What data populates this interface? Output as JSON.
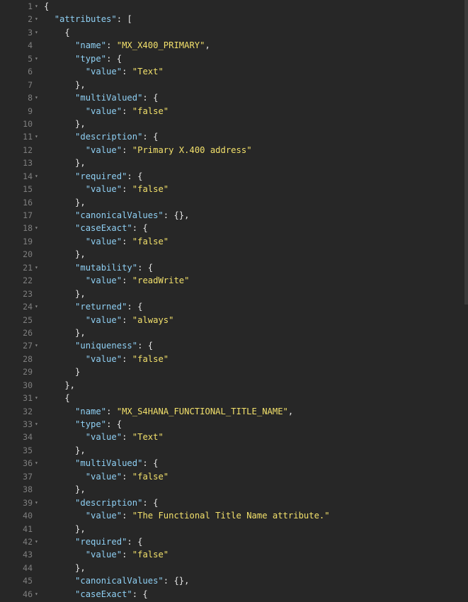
{
  "editor": {
    "lines": [
      {
        "n": "1",
        "fold": true,
        "tokens": [
          {
            "t": "{",
            "c": "punc"
          }
        ]
      },
      {
        "n": "2",
        "fold": true,
        "tokens": [
          {
            "t": "  ",
            "c": "punc"
          },
          {
            "t": "\"attributes\"",
            "c": "key"
          },
          {
            "t": ": [",
            "c": "punc"
          }
        ]
      },
      {
        "n": "3",
        "fold": true,
        "tokens": [
          {
            "t": "    {",
            "c": "punc"
          }
        ]
      },
      {
        "n": "4",
        "fold": false,
        "tokens": [
          {
            "t": "      ",
            "c": "punc"
          },
          {
            "t": "\"name\"",
            "c": "key"
          },
          {
            "t": ": ",
            "c": "punc"
          },
          {
            "t": "\"MX_X400_PRIMARY\"",
            "c": "str"
          },
          {
            "t": ",",
            "c": "punc"
          }
        ]
      },
      {
        "n": "5",
        "fold": true,
        "tokens": [
          {
            "t": "      ",
            "c": "punc"
          },
          {
            "t": "\"type\"",
            "c": "key"
          },
          {
            "t": ": {",
            "c": "punc"
          }
        ]
      },
      {
        "n": "6",
        "fold": false,
        "tokens": [
          {
            "t": "        ",
            "c": "punc"
          },
          {
            "t": "\"value\"",
            "c": "key"
          },
          {
            "t": ": ",
            "c": "punc"
          },
          {
            "t": "\"Text\"",
            "c": "str"
          }
        ]
      },
      {
        "n": "7",
        "fold": false,
        "tokens": [
          {
            "t": "      },",
            "c": "punc"
          }
        ]
      },
      {
        "n": "8",
        "fold": true,
        "tokens": [
          {
            "t": "      ",
            "c": "punc"
          },
          {
            "t": "\"multiValued\"",
            "c": "key"
          },
          {
            "t": ": {",
            "c": "punc"
          }
        ]
      },
      {
        "n": "9",
        "fold": false,
        "tokens": [
          {
            "t": "        ",
            "c": "punc"
          },
          {
            "t": "\"value\"",
            "c": "key"
          },
          {
            "t": ": ",
            "c": "punc"
          },
          {
            "t": "\"false\"",
            "c": "str"
          }
        ]
      },
      {
        "n": "10",
        "fold": false,
        "tokens": [
          {
            "t": "      },",
            "c": "punc"
          }
        ]
      },
      {
        "n": "11",
        "fold": true,
        "tokens": [
          {
            "t": "      ",
            "c": "punc"
          },
          {
            "t": "\"description\"",
            "c": "key"
          },
          {
            "t": ": {",
            "c": "punc"
          }
        ]
      },
      {
        "n": "12",
        "fold": false,
        "tokens": [
          {
            "t": "        ",
            "c": "punc"
          },
          {
            "t": "\"value\"",
            "c": "key"
          },
          {
            "t": ": ",
            "c": "punc"
          },
          {
            "t": "\"Primary X.400 address\"",
            "c": "str"
          }
        ]
      },
      {
        "n": "13",
        "fold": false,
        "tokens": [
          {
            "t": "      },",
            "c": "punc"
          }
        ]
      },
      {
        "n": "14",
        "fold": true,
        "tokens": [
          {
            "t": "      ",
            "c": "punc"
          },
          {
            "t": "\"required\"",
            "c": "key"
          },
          {
            "t": ": {",
            "c": "punc"
          }
        ]
      },
      {
        "n": "15",
        "fold": false,
        "tokens": [
          {
            "t": "        ",
            "c": "punc"
          },
          {
            "t": "\"value\"",
            "c": "key"
          },
          {
            "t": ": ",
            "c": "punc"
          },
          {
            "t": "\"false\"",
            "c": "str"
          }
        ]
      },
      {
        "n": "16",
        "fold": false,
        "tokens": [
          {
            "t": "      },",
            "c": "punc"
          }
        ]
      },
      {
        "n": "17",
        "fold": false,
        "tokens": [
          {
            "t": "      ",
            "c": "punc"
          },
          {
            "t": "\"canonicalValues\"",
            "c": "key"
          },
          {
            "t": ": {},",
            "c": "punc"
          }
        ]
      },
      {
        "n": "18",
        "fold": true,
        "tokens": [
          {
            "t": "      ",
            "c": "punc"
          },
          {
            "t": "\"caseExact\"",
            "c": "key"
          },
          {
            "t": ": {",
            "c": "punc"
          }
        ]
      },
      {
        "n": "19",
        "fold": false,
        "tokens": [
          {
            "t": "        ",
            "c": "punc"
          },
          {
            "t": "\"value\"",
            "c": "key"
          },
          {
            "t": ": ",
            "c": "punc"
          },
          {
            "t": "\"false\"",
            "c": "str"
          }
        ]
      },
      {
        "n": "20",
        "fold": false,
        "tokens": [
          {
            "t": "      },",
            "c": "punc"
          }
        ]
      },
      {
        "n": "21",
        "fold": true,
        "tokens": [
          {
            "t": "      ",
            "c": "punc"
          },
          {
            "t": "\"mutability\"",
            "c": "key"
          },
          {
            "t": ": {",
            "c": "punc"
          }
        ]
      },
      {
        "n": "22",
        "fold": false,
        "tokens": [
          {
            "t": "        ",
            "c": "punc"
          },
          {
            "t": "\"value\"",
            "c": "key"
          },
          {
            "t": ": ",
            "c": "punc"
          },
          {
            "t": "\"readWrite\"",
            "c": "str"
          }
        ]
      },
      {
        "n": "23",
        "fold": false,
        "tokens": [
          {
            "t": "      },",
            "c": "punc"
          }
        ]
      },
      {
        "n": "24",
        "fold": true,
        "tokens": [
          {
            "t": "      ",
            "c": "punc"
          },
          {
            "t": "\"returned\"",
            "c": "key"
          },
          {
            "t": ": {",
            "c": "punc"
          }
        ]
      },
      {
        "n": "25",
        "fold": false,
        "tokens": [
          {
            "t": "        ",
            "c": "punc"
          },
          {
            "t": "\"value\"",
            "c": "key"
          },
          {
            "t": ": ",
            "c": "punc"
          },
          {
            "t": "\"always\"",
            "c": "str"
          }
        ]
      },
      {
        "n": "26",
        "fold": false,
        "tokens": [
          {
            "t": "      },",
            "c": "punc"
          }
        ]
      },
      {
        "n": "27",
        "fold": true,
        "tokens": [
          {
            "t": "      ",
            "c": "punc"
          },
          {
            "t": "\"uniqueness\"",
            "c": "key"
          },
          {
            "t": ": {",
            "c": "punc"
          }
        ]
      },
      {
        "n": "28",
        "fold": false,
        "tokens": [
          {
            "t": "        ",
            "c": "punc"
          },
          {
            "t": "\"value\"",
            "c": "key"
          },
          {
            "t": ": ",
            "c": "punc"
          },
          {
            "t": "\"false\"",
            "c": "str"
          }
        ]
      },
      {
        "n": "29",
        "fold": false,
        "tokens": [
          {
            "t": "      }",
            "c": "punc"
          }
        ]
      },
      {
        "n": "30",
        "fold": false,
        "tokens": [
          {
            "t": "    },",
            "c": "punc"
          }
        ]
      },
      {
        "n": "31",
        "fold": true,
        "tokens": [
          {
            "t": "    {",
            "c": "punc"
          }
        ]
      },
      {
        "n": "32",
        "fold": false,
        "tokens": [
          {
            "t": "      ",
            "c": "punc"
          },
          {
            "t": "\"name\"",
            "c": "key"
          },
          {
            "t": ": ",
            "c": "punc"
          },
          {
            "t": "\"MX_S4HANA_FUNCTIONAL_TITLE_NAME\"",
            "c": "str"
          },
          {
            "t": ",",
            "c": "punc"
          }
        ]
      },
      {
        "n": "33",
        "fold": true,
        "tokens": [
          {
            "t": "      ",
            "c": "punc"
          },
          {
            "t": "\"type\"",
            "c": "key"
          },
          {
            "t": ": {",
            "c": "punc"
          }
        ]
      },
      {
        "n": "34",
        "fold": false,
        "tokens": [
          {
            "t": "        ",
            "c": "punc"
          },
          {
            "t": "\"value\"",
            "c": "key"
          },
          {
            "t": ": ",
            "c": "punc"
          },
          {
            "t": "\"Text\"",
            "c": "str"
          }
        ]
      },
      {
        "n": "35",
        "fold": false,
        "tokens": [
          {
            "t": "      },",
            "c": "punc"
          }
        ]
      },
      {
        "n": "36",
        "fold": true,
        "tokens": [
          {
            "t": "      ",
            "c": "punc"
          },
          {
            "t": "\"multiValued\"",
            "c": "key"
          },
          {
            "t": ": {",
            "c": "punc"
          }
        ]
      },
      {
        "n": "37",
        "fold": false,
        "tokens": [
          {
            "t": "        ",
            "c": "punc"
          },
          {
            "t": "\"value\"",
            "c": "key"
          },
          {
            "t": ": ",
            "c": "punc"
          },
          {
            "t": "\"false\"",
            "c": "str"
          }
        ]
      },
      {
        "n": "38",
        "fold": false,
        "tokens": [
          {
            "t": "      },",
            "c": "punc"
          }
        ]
      },
      {
        "n": "39",
        "fold": true,
        "tokens": [
          {
            "t": "      ",
            "c": "punc"
          },
          {
            "t": "\"description\"",
            "c": "key"
          },
          {
            "t": ": {",
            "c": "punc"
          }
        ]
      },
      {
        "n": "40",
        "fold": false,
        "tokens": [
          {
            "t": "        ",
            "c": "punc"
          },
          {
            "t": "\"value\"",
            "c": "key"
          },
          {
            "t": ": ",
            "c": "punc"
          },
          {
            "t": "\"The Functional Title Name attribute.\"",
            "c": "str"
          }
        ]
      },
      {
        "n": "41",
        "fold": false,
        "tokens": [
          {
            "t": "      },",
            "c": "punc"
          }
        ]
      },
      {
        "n": "42",
        "fold": true,
        "tokens": [
          {
            "t": "      ",
            "c": "punc"
          },
          {
            "t": "\"required\"",
            "c": "key"
          },
          {
            "t": ": {",
            "c": "punc"
          }
        ]
      },
      {
        "n": "43",
        "fold": false,
        "tokens": [
          {
            "t": "        ",
            "c": "punc"
          },
          {
            "t": "\"value\"",
            "c": "key"
          },
          {
            "t": ": ",
            "c": "punc"
          },
          {
            "t": "\"false\"",
            "c": "str"
          }
        ]
      },
      {
        "n": "44",
        "fold": false,
        "tokens": [
          {
            "t": "      },",
            "c": "punc"
          }
        ]
      },
      {
        "n": "45",
        "fold": false,
        "tokens": [
          {
            "t": "      ",
            "c": "punc"
          },
          {
            "t": "\"canonicalValues\"",
            "c": "key"
          },
          {
            "t": ": {},",
            "c": "punc"
          }
        ]
      },
      {
        "n": "46",
        "fold": true,
        "tokens": [
          {
            "t": "      ",
            "c": "punc"
          },
          {
            "t": "\"caseExact\"",
            "c": "key"
          },
          {
            "t": ": {",
            "c": "punc"
          }
        ]
      }
    ],
    "fold_glyph": "▾",
    "colors": {
      "background": "#272727",
      "line_number": "#7f7f7f",
      "key": "#8fd0f4",
      "string": "#f2e06b",
      "punctuation": "#e6e6e6"
    }
  }
}
